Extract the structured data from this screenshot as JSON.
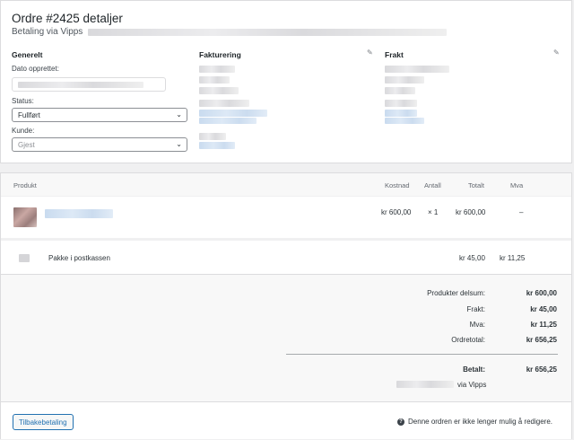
{
  "header": {
    "title": "Ordre #2425 detaljer",
    "subtitle": "Betaling via Vipps"
  },
  "general": {
    "heading": "Generelt",
    "date_label": "Dato opprettet:",
    "status_label": "Status:",
    "status_value": "Fullført",
    "customer_label": "Kunde:",
    "customer_placeholder": "Gjest"
  },
  "billing": {
    "heading": "Fakturering"
  },
  "shipping": {
    "heading": "Frakt"
  },
  "items": {
    "columns": {
      "product": "Produkt",
      "cost": "Kostnad",
      "qty": "Antall",
      "total": "Totalt",
      "vat": "Mva"
    },
    "product_row": {
      "cost": "kr 600,00",
      "qty": "× 1",
      "total": "kr 600,00",
      "vat": "–"
    },
    "shipping_row": {
      "name": "Pakke i postkassen",
      "total": "kr 45,00",
      "vat": "kr 11,25"
    }
  },
  "totals": {
    "subtotal_label": "Produkter delsum:",
    "subtotal_value": "kr 600,00",
    "shipping_label": "Frakt:",
    "shipping_value": "kr 45,00",
    "vat_label": "Mva:",
    "vat_value": "kr 11,25",
    "order_total_label": "Ordretotal:",
    "order_total_value": "kr 656,25",
    "paid_label": "Betalt:",
    "paid_value": "kr 656,25",
    "paid_via": "via Vipps"
  },
  "footer": {
    "refund_label": "Tilbakebetaling",
    "notice": "Denne ordren er ikke lenger mulig å redigere."
  }
}
